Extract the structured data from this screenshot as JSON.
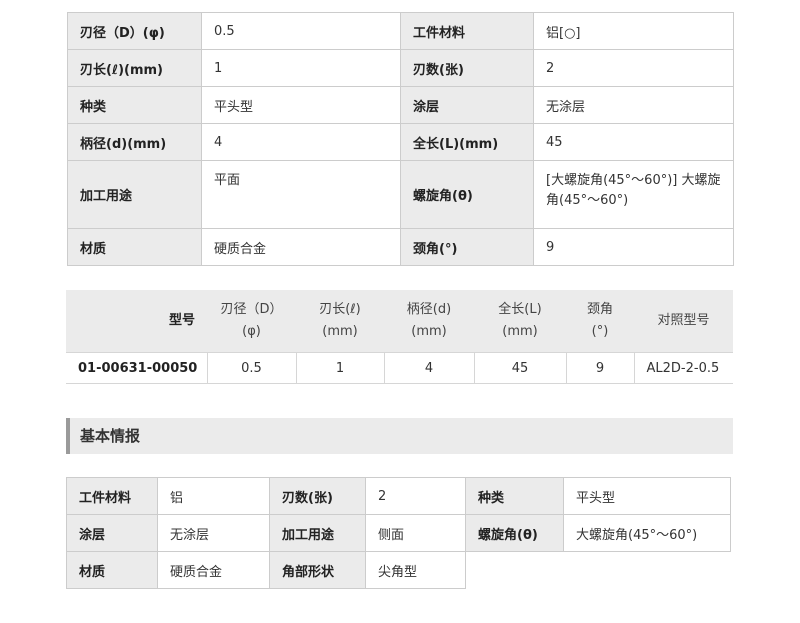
{
  "spec_table": {
    "rows": [
      [
        {
          "label": "刃径（D）(φ)",
          "value": "0.5"
        },
        {
          "label": "工件材料",
          "value": "铝[○]"
        }
      ],
      [
        {
          "label": "刃长(ℓ)(mm)",
          "value": "1"
        },
        {
          "label": "刃数(张)",
          "value": "2"
        }
      ],
      [
        {
          "label": "种类",
          "value": "平头型"
        },
        {
          "label": "涂层",
          "value": "无涂层"
        }
      ],
      [
        {
          "label": "柄径(d)(mm)",
          "value": "4"
        },
        {
          "label": "全长(L)(mm)",
          "value": "45"
        }
      ],
      [
        {
          "label": "加工用途",
          "value": "平面"
        },
        {
          "label": "螺旋角(θ)",
          "value": "[大螺旋角(45°～60°)] 大螺旋角(45°～60°)"
        }
      ],
      [
        {
          "label": "材质",
          "value": "硬质合金"
        },
        {
          "label": "颈角(°)",
          "value": "9"
        }
      ]
    ]
  },
  "model_table": {
    "headers": [
      {
        "line1": "型号",
        "line2": ""
      },
      {
        "line1": "刃径（D）",
        "line2": "(φ)"
      },
      {
        "line1": "刃长(ℓ)",
        "line2": "(mm)"
      },
      {
        "line1": "柄径(d)",
        "line2": "(mm)"
      },
      {
        "line1": "全长(L)",
        "line2": "(mm)"
      },
      {
        "line1": "颈角",
        "line2": "(°)"
      },
      {
        "line1": "对照型号",
        "line2": ""
      }
    ],
    "row": [
      "01-00631-00050",
      "0.5",
      "1",
      "4",
      "45",
      "9",
      "AL2D-2-0.5"
    ]
  },
  "section_title": "基本情报",
  "basic_table": {
    "rows": [
      [
        {
          "label": "工件材料",
          "value": "铝"
        },
        {
          "label": "刃数(张)",
          "value": "2"
        },
        {
          "label": "种类",
          "value": "平头型"
        }
      ],
      [
        {
          "label": "涂层",
          "value": "无涂层"
        },
        {
          "label": "加工用途",
          "value": "侧面"
        },
        {
          "label": "螺旋角(θ)",
          "value": "大螺旋角(45°～60°)"
        }
      ],
      [
        {
          "label": "材质",
          "value": "硬质合金"
        },
        {
          "label": "角部形状",
          "value": "尖角型"
        }
      ]
    ]
  }
}
